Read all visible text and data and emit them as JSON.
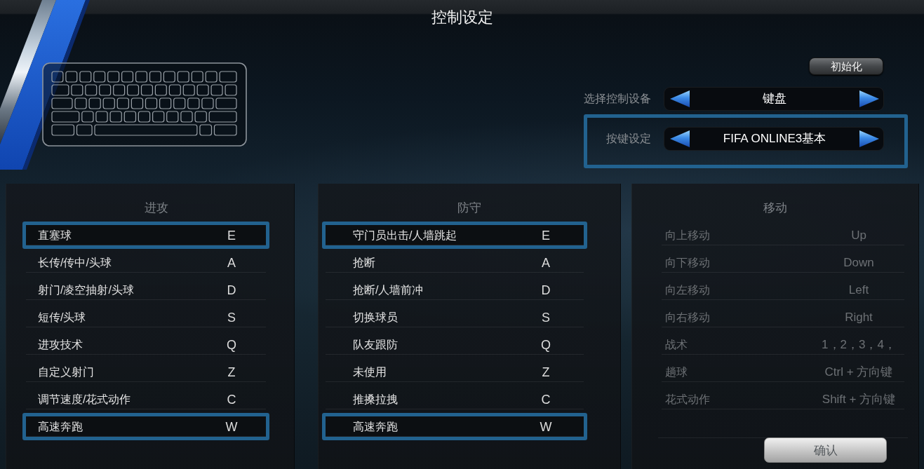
{
  "title": "控制设定",
  "reset_button": "初始化",
  "settings": [
    {
      "label": "选择控制设备",
      "value": "键盘",
      "highlighted": false
    },
    {
      "label": "按键设定",
      "value": "FIFA ONLINE3基本",
      "highlighted": true
    }
  ],
  "columns": [
    {
      "heading": "进攻",
      "rows": [
        {
          "action": "直塞球",
          "key": "E",
          "highlighted": true,
          "disabled": false
        },
        {
          "action": "长传/传中/头球",
          "key": "A",
          "highlighted": false,
          "disabled": false
        },
        {
          "action": "射门/凌空抽射/头球",
          "key": "D",
          "highlighted": false,
          "disabled": false
        },
        {
          "action": "短传/头球",
          "key": "S",
          "highlighted": false,
          "disabled": false
        },
        {
          "action": "进攻技术",
          "key": "Q",
          "highlighted": false,
          "disabled": false
        },
        {
          "action": "自定义射门",
          "key": "Z",
          "highlighted": false,
          "disabled": false
        },
        {
          "action": "调节速度/花式动作",
          "key": "C",
          "highlighted": false,
          "disabled": false
        },
        {
          "action": "高速奔跑",
          "key": "W",
          "highlighted": true,
          "disabled": false
        }
      ]
    },
    {
      "heading": "防守",
      "rows": [
        {
          "action": "守门员出击/人墙跳起",
          "key": "E",
          "highlighted": true,
          "disabled": false
        },
        {
          "action": "抢断",
          "key": "A",
          "highlighted": false,
          "disabled": false
        },
        {
          "action": "抢断/人墙前冲",
          "key": "D",
          "highlighted": false,
          "disabled": false
        },
        {
          "action": "切换球员",
          "key": "S",
          "highlighted": false,
          "disabled": false
        },
        {
          "action": "队友跟防",
          "key": "Q",
          "highlighted": false,
          "disabled": false
        },
        {
          "action": "未使用",
          "key": "Z",
          "highlighted": false,
          "disabled": false
        },
        {
          "action": "推搡拉拽",
          "key": "C",
          "highlighted": false,
          "disabled": false
        },
        {
          "action": "高速奔跑",
          "key": "W",
          "highlighted": true,
          "disabled": false
        }
      ]
    },
    {
      "heading": "移动",
      "rows": [
        {
          "action": "向上移动",
          "key": "Up",
          "highlighted": false,
          "disabled": true
        },
        {
          "action": "向下移动",
          "key": "Down",
          "highlighted": false,
          "disabled": true
        },
        {
          "action": "向左移动",
          "key": "Left",
          "highlighted": false,
          "disabled": true
        },
        {
          "action": "向右移动",
          "key": "Right",
          "highlighted": false,
          "disabled": true
        },
        {
          "action": "战术",
          "key": "1，2，3，4，",
          "highlighted": false,
          "disabled": true
        },
        {
          "action": "趟球",
          "key": "Ctrl + 方向键",
          "highlighted": false,
          "disabled": true
        },
        {
          "action": "花式动作",
          "key": "Shift + 方向键",
          "highlighted": false,
          "disabled": true
        }
      ]
    }
  ],
  "confirm_button": "确认"
}
